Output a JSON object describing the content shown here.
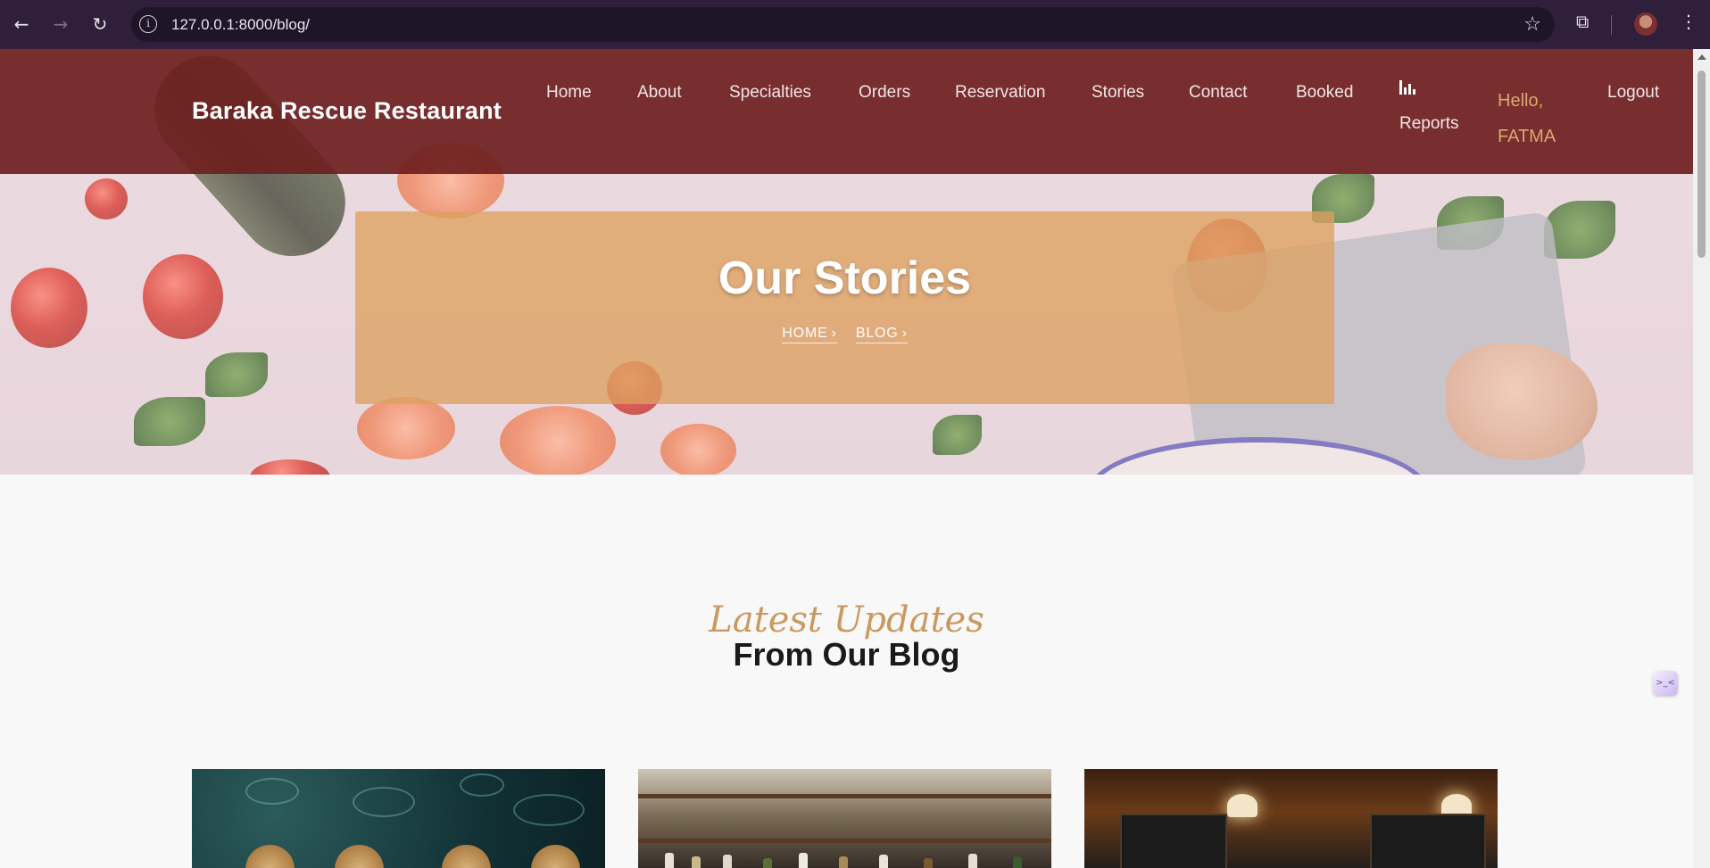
{
  "browser": {
    "url": "127.0.0.1:8000/blog/",
    "icons": [
      "back-arrow-icon",
      "forward-arrow-icon",
      "reload-icon",
      "site-info-icon",
      "bookmark-star-icon",
      "extensions-icon",
      "profile-avatar",
      "menu-kebab-icon"
    ]
  },
  "navbar": {
    "brand": "Baraka Rescue Restaurant",
    "links": {
      "home": "Home",
      "about": "About",
      "specialties": "Specialties",
      "orders": "Orders",
      "reservation": "Reservation",
      "stories": "Stories",
      "contact": "Contact",
      "booked": "Booked",
      "reports": "Reports",
      "logout": "Logout"
    },
    "greeting_line1": "Hello,",
    "greeting_line2": "FATMA"
  },
  "hero": {
    "title": "Our Stories",
    "breadcrumbs": [
      "HOME",
      "BLOG"
    ]
  },
  "section": {
    "subheading": "Latest Updates",
    "heading": "From Our Blog"
  },
  "colors": {
    "navbar": "#6e2020",
    "accent_gold": "#d9a86c",
    "hero_panel": "#dca05f"
  }
}
